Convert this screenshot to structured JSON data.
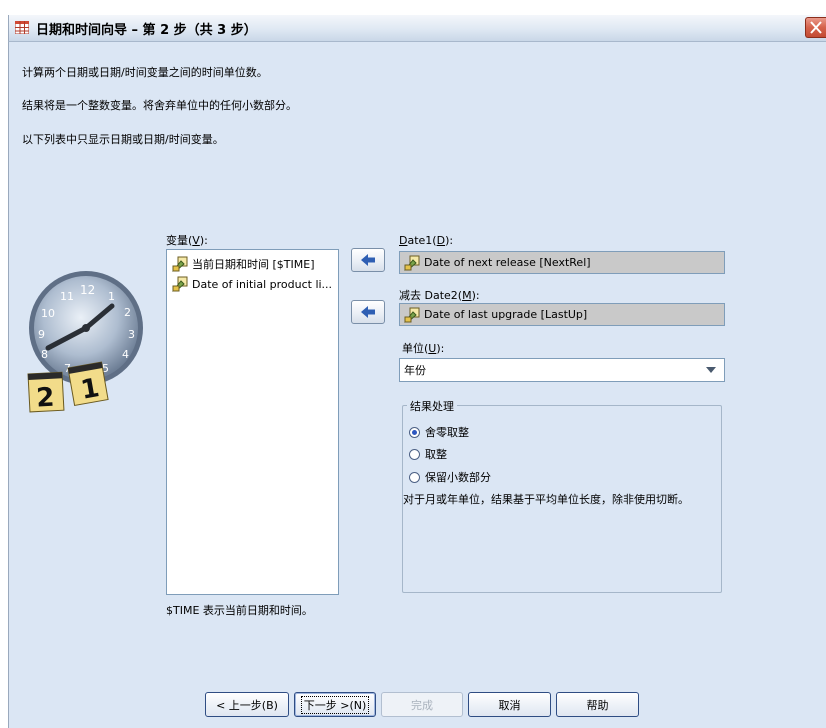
{
  "window": {
    "title": "日期和时间向导 – 第 2 步（共 3 步）"
  },
  "instructions": [
    "计算两个日期或日期/时间变量之间的时间单位数。",
    "结果将是一个整数变量。将舍弃单位中的任何小数部分。",
    "以下列表中只显示日期或日期/时间变量。"
  ],
  "variables": {
    "label": "变量(",
    "mnemonic": "V",
    "label_end": "):",
    "items": [
      {
        "label": "当前日期和时间 [$TIME]"
      },
      {
        "label": "Date of initial product li..."
      }
    ]
  },
  "date1": {
    "label_mnemonic": "D",
    "label_prefix": "ate1(",
    "label_end": "):",
    "mnemonic_text": "D",
    "value": "Date of next release [NextRel]"
  },
  "date2": {
    "label_prefix": "减去 Date2(",
    "mnemonic": "M",
    "label_end": "):",
    "value": "Date of last upgrade [LastUp]"
  },
  "unit": {
    "label": "单位(",
    "mnemonic": "U",
    "label_end": "):",
    "selected": "年份"
  },
  "result_handling": {
    "title": "结果处理",
    "options": [
      {
        "label": "舍零取整",
        "selected": true
      },
      {
        "label": "取整",
        "selected": false
      },
      {
        "label": "保留小数部分",
        "selected": false
      }
    ],
    "note": "对于月或年单位，结果基于平均单位长度，除非使用切断。"
  },
  "footer_note": "$TIME 表示当前日期和时间。",
  "buttons": {
    "back": "< 上一步(B)",
    "next": "下一步 >(N)",
    "finish": "完成",
    "cancel": "取消",
    "help": "帮助"
  },
  "colors": {
    "dialog_bg": "#dbe6f4",
    "field_disabled_bg": "#c9c9c9",
    "arrow_blue": "#2f5fb3"
  },
  "clock_icon": {
    "name": "clock-calendar-icon",
    "calendar_digits": [
      "2",
      "1"
    ]
  }
}
